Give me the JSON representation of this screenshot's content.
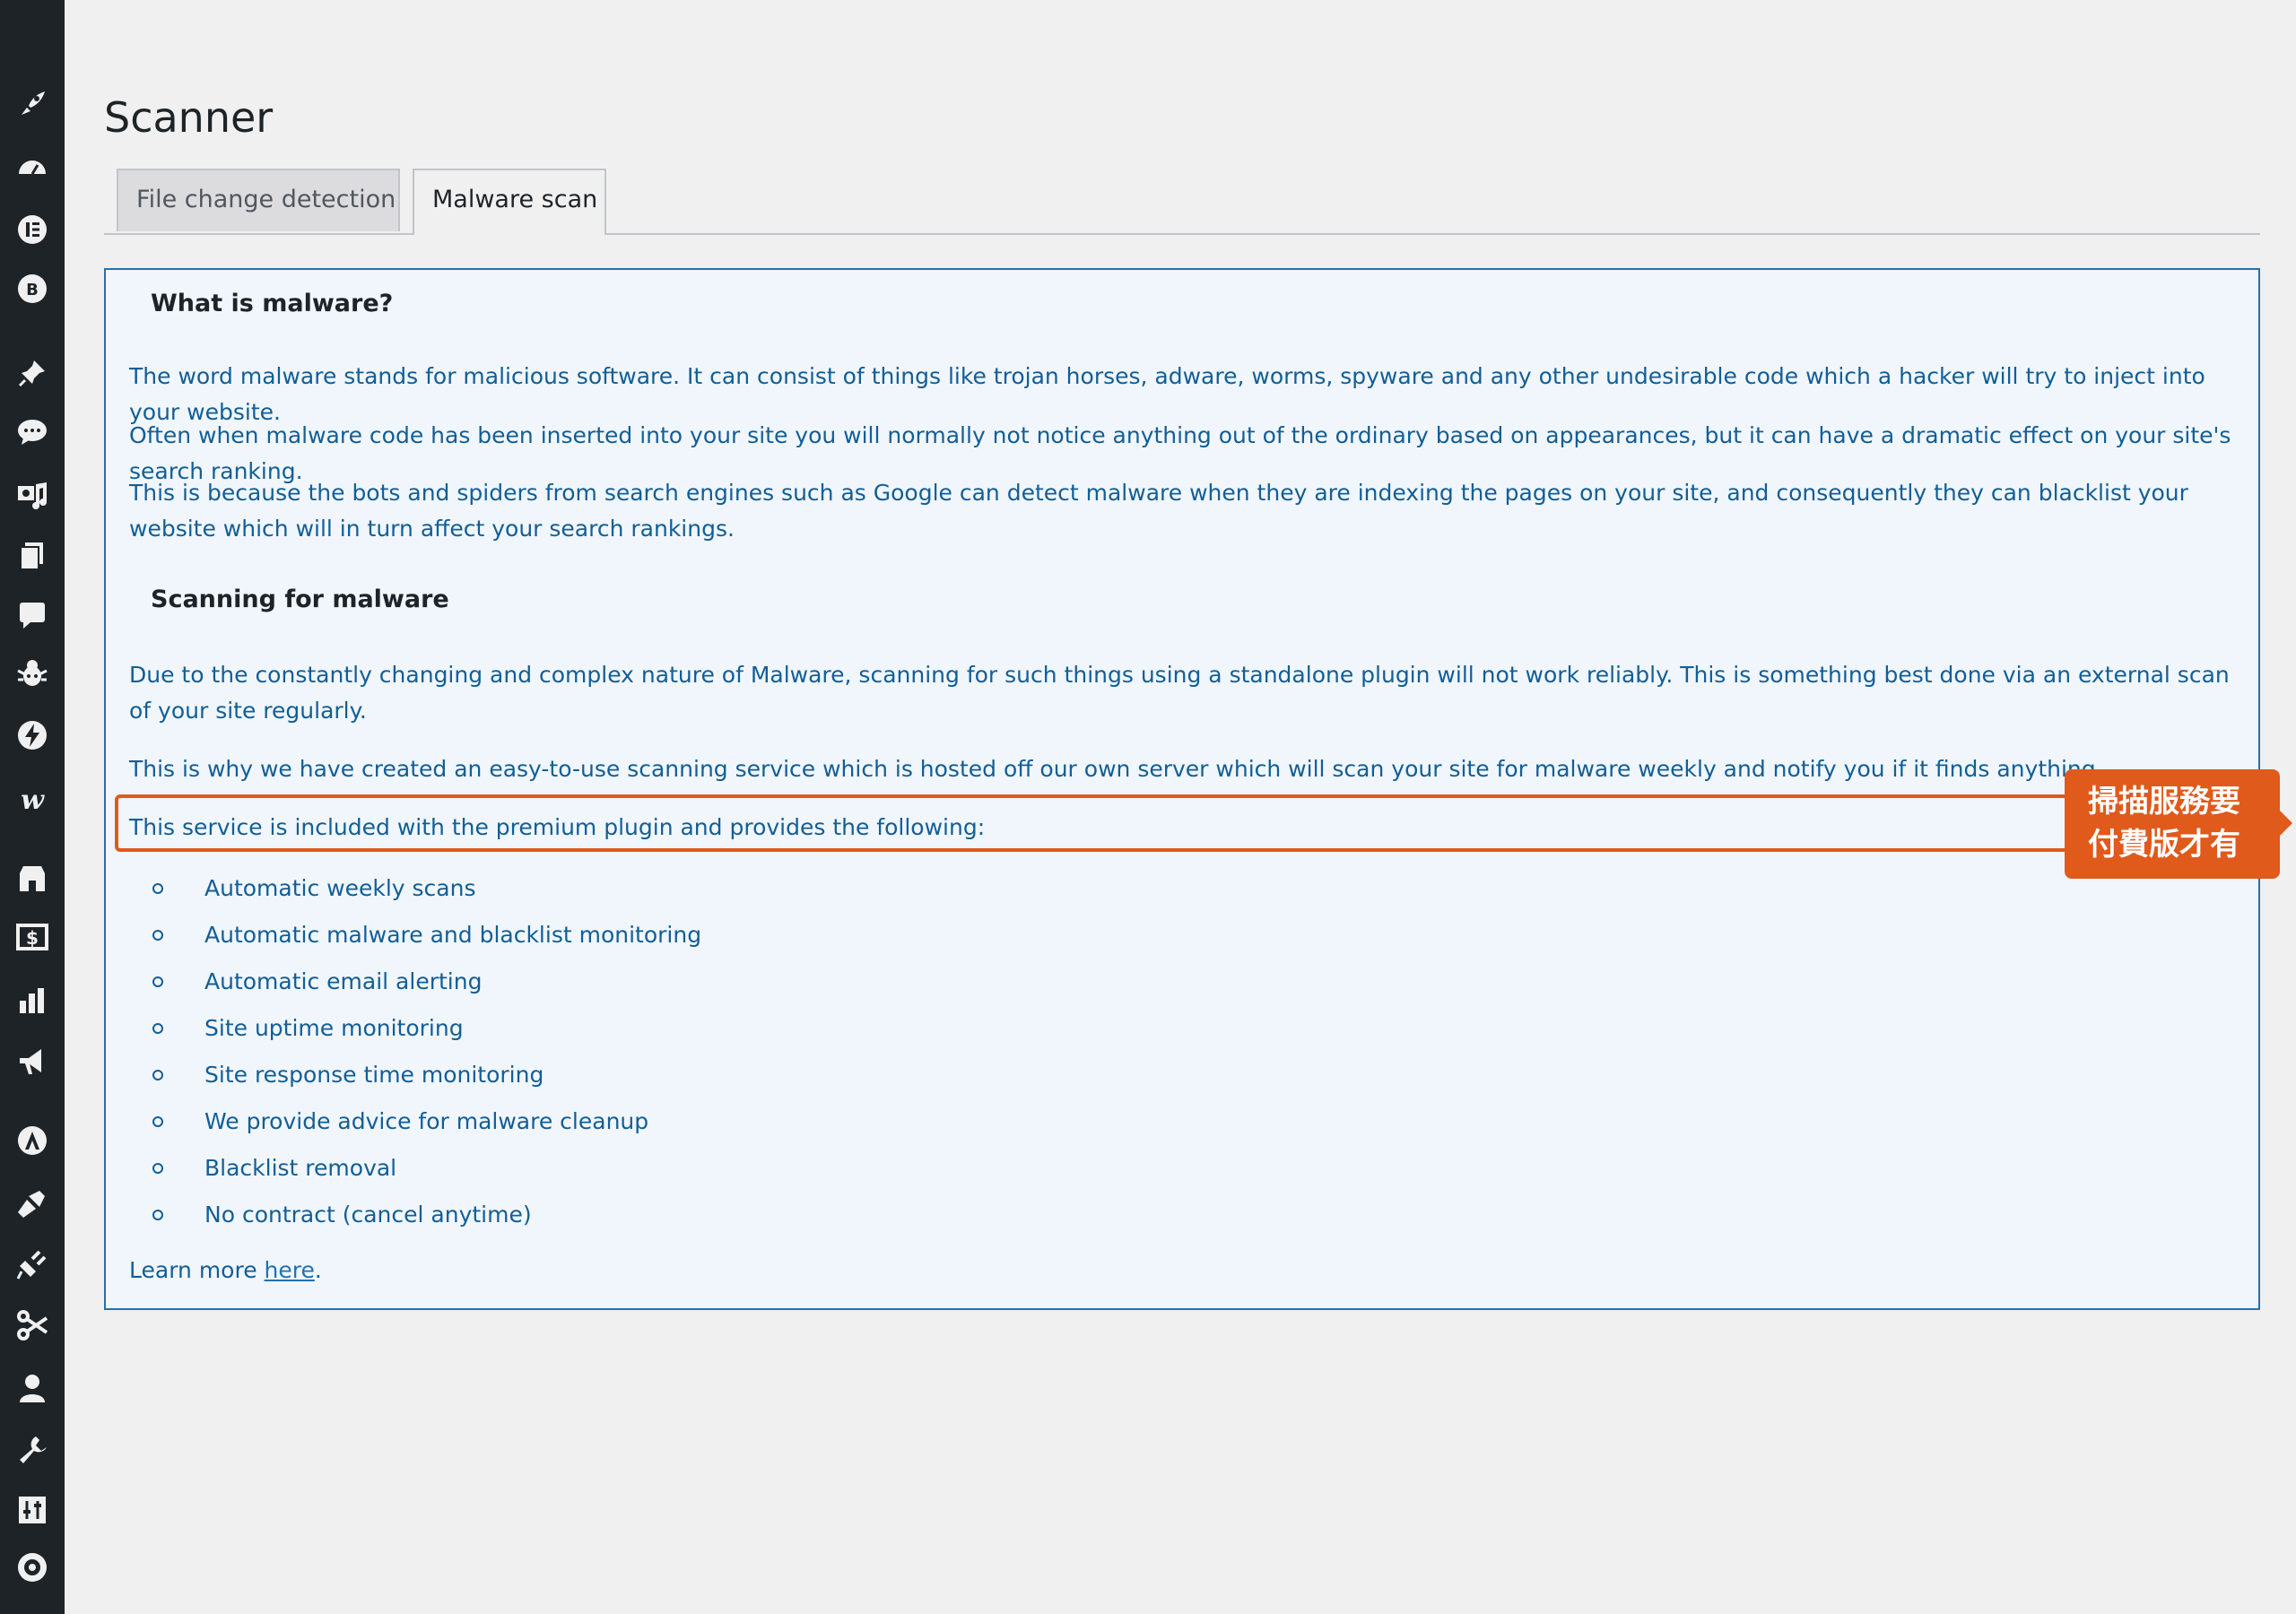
{
  "sidebar": {
    "icons": [
      "rocket-icon",
      "dashboard-icon",
      "elementor-icon",
      "b-icon",
      "pin-icon",
      "comments-icon",
      "media-icon",
      "pages-icon",
      "feedback-icon",
      "bug-icon",
      "bolt-icon",
      "w-icon",
      "store-icon",
      "dollar-icon",
      "stats-icon",
      "megaphone-icon",
      "a-icon",
      "brush-icon",
      "plugin-icon",
      "scissors-icon",
      "user-icon",
      "wrench-icon",
      "settings-slider-icon",
      "gear-icon"
    ]
  },
  "page": {
    "title": "Scanner"
  },
  "tabs": [
    {
      "label": "File change detection",
      "active": false
    },
    {
      "label": "Malware scan",
      "active": true
    }
  ],
  "panel": {
    "heading1": "What is malware?",
    "p1": "The word malware stands for malicious software. It can consist of things like trojan horses, adware, worms, spyware and any other undesirable code which a hacker will try to inject into your website.",
    "p2": "Often when malware code has been inserted into your site you will normally not notice anything out of the ordinary based on appearances, but it can have a dramatic effect on your site's search ranking.",
    "p3": "This is because the bots and spiders from search engines such as Google can detect malware when they are indexing the pages on your site, and consequently they can blacklist your website which will in turn affect your search rankings.",
    "heading2": "Scanning for malware",
    "p4": "Due to the constantly changing and complex nature of Malware, scanning for such things using a standalone plugin will not work reliably. This is something best done via an external scan of your site regularly.",
    "p5": "This is why we have created an easy-to-use scanning service which is hosted off our own server which will scan your site for malware weekly and notify you if it finds anything.",
    "p6": "This service is included with the premium plugin and provides the following:",
    "features": [
      "Automatic weekly scans",
      "Automatic malware and blacklist monitoring",
      "Automatic email alerting",
      "Site uptime monitoring",
      "Site response time monitoring",
      "We provide advice for malware cleanup",
      "Blacklist removal",
      "No contract (cancel anytime)"
    ],
    "learn_more_prefix": "Learn more ",
    "learn_more_link": "here",
    "learn_more_suffix": "."
  },
  "annotation": {
    "line1": "掃描服務要",
    "line2": "付費版才有",
    "color": "#e05a1c"
  },
  "colors": {
    "sidebar": "#1d2327",
    "link": "#135e96",
    "panel_border": "#2271b1",
    "panel_bg": "#f0f6fc"
  }
}
